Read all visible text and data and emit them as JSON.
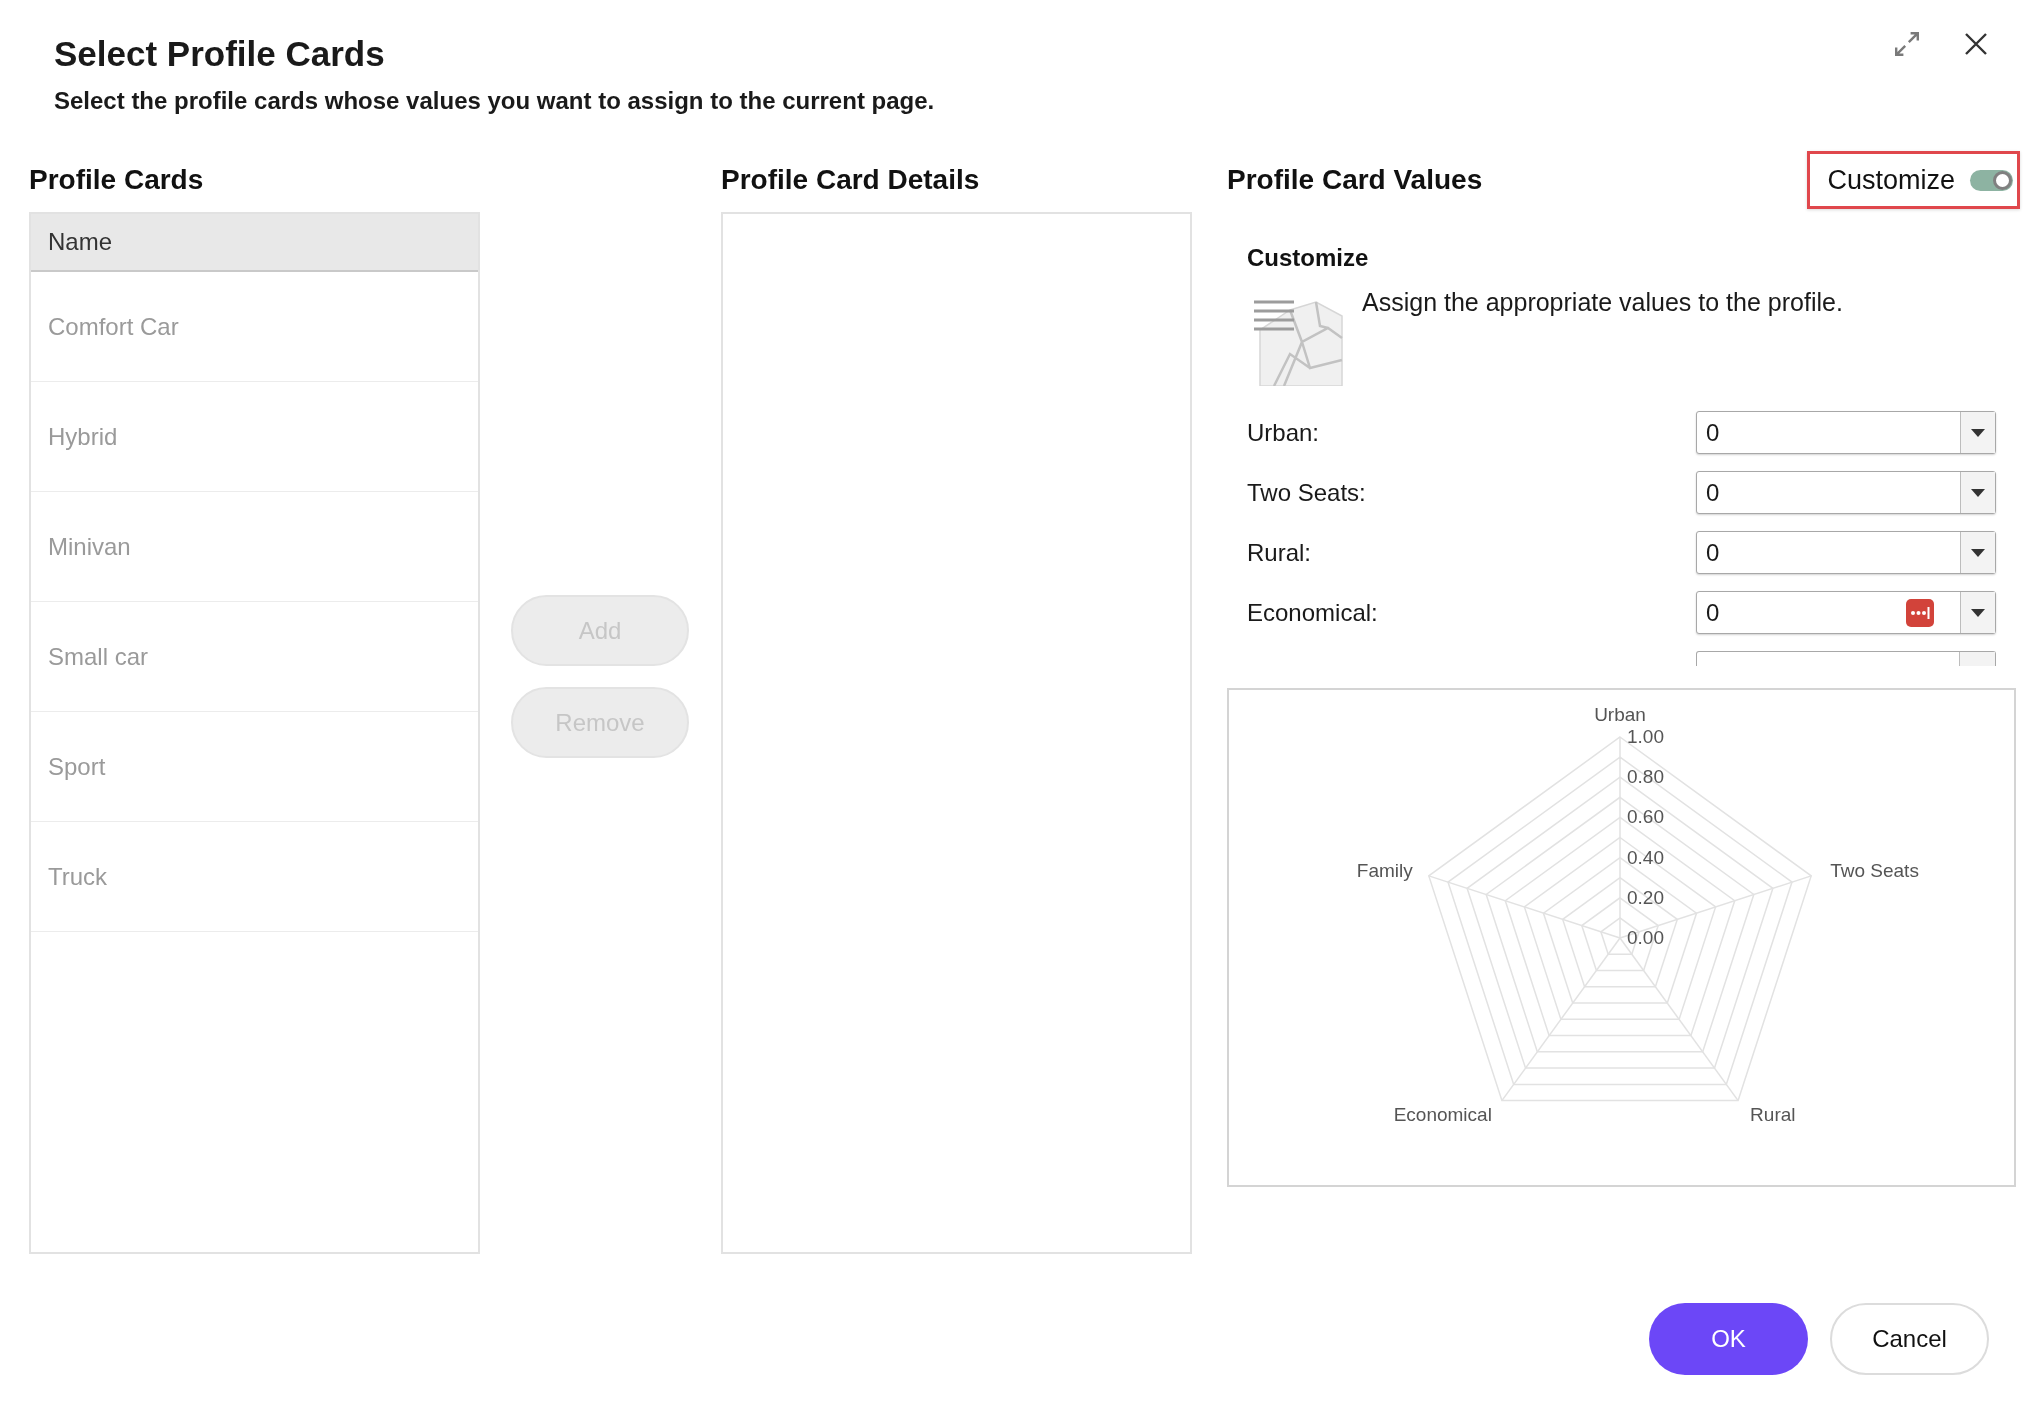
{
  "dialog": {
    "title": "Select Profile Cards",
    "subtitle": "Select the profile cards whose values you want to assign to the current page."
  },
  "profile_cards": {
    "heading": "Profile Cards",
    "columns": [
      "Name"
    ],
    "rows": [
      {
        "name": "Comfort Car",
        "selected": false
      },
      {
        "name": "Hybrid",
        "selected": false
      },
      {
        "name": "Minivan",
        "selected": false
      },
      {
        "name": "Small car",
        "selected": false
      },
      {
        "name": "Sport",
        "selected": false
      },
      {
        "name": "Truck",
        "selected": false
      }
    ]
  },
  "actions": [
    {
      "label": "Add",
      "disabled": true
    },
    {
      "label": "Remove",
      "disabled": true
    }
  ],
  "details": {
    "heading": "Profile Card Details"
  },
  "values": {
    "heading": "Profile Card Values",
    "customize_toggle": {
      "label": "Customize",
      "on": true,
      "highlighted": true
    },
    "section_title": "Customize",
    "description": "Assign the appropriate values to the profile.",
    "fields": [
      {
        "kind": "dropdown",
        "label": "Urban:",
        "value": "0",
        "badge": false
      },
      {
        "kind": "dropdown",
        "label": "Two Seats:",
        "value": "0",
        "badge": false
      },
      {
        "kind": "dropdown",
        "label": "Rural:",
        "value": "0",
        "badge": false
      },
      {
        "kind": "dropdown",
        "label": "Economical:",
        "value": "0",
        "badge": true
      },
      {
        "kind": "clipped"
      }
    ],
    "radar_chart": {
      "axes": [
        "Urban",
        "Two Seats",
        "Rural",
        "Economical",
        "Family"
      ],
      "ticks": [
        "1.00",
        "0.80",
        "0.60",
        "0.40",
        "0.20",
        "0.00"
      ]
    }
  },
  "footer": {
    "buttons": [
      {
        "label": "OK",
        "kind": "primary"
      },
      {
        "label": "Cancel",
        "kind": "secondary"
      }
    ]
  }
}
